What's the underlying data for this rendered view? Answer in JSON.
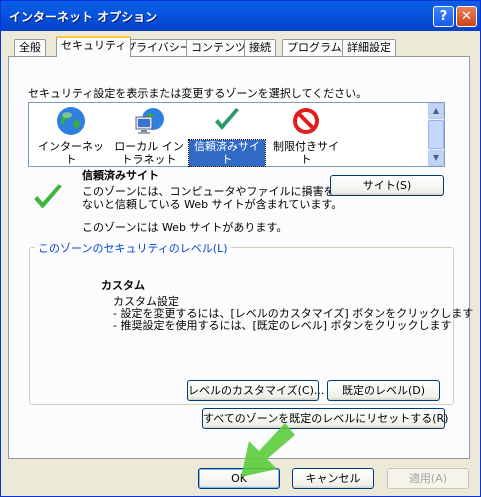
{
  "window": {
    "title": "インターネット オプション"
  },
  "tabs": [
    {
      "label": "全般"
    },
    {
      "label": "セキュリティ"
    },
    {
      "label": "プライバシー"
    },
    {
      "label": "コンテンツ"
    },
    {
      "label": "接続"
    },
    {
      "label": "プログラム"
    },
    {
      "label": "詳細設定"
    }
  ],
  "zones": {
    "prompt": "セキュリティ設定を表示または変更するゾーンを選択してください。",
    "items": [
      {
        "label": "インターネット",
        "icon": "globe-icon"
      },
      {
        "label": "ローカル イントラネット",
        "icon": "intranet-icon"
      },
      {
        "label": "信頼済みサイト",
        "icon": "checkmark-icon"
      },
      {
        "label": "制限付きサイト",
        "icon": "restricted-icon"
      }
    ],
    "selected": 2
  },
  "zone_info": {
    "title": "信頼済みサイト",
    "desc1": "このゾーンには、コンピュータやファイルに損害を与え",
    "desc2": "ないと信頼している Web サイトが含まれています。",
    "note": "このゾーンには Web サイトがあります。",
    "sites_button": "サイト(S)"
  },
  "level_group": {
    "legend": "このゾーンのセキュリティのレベル(L)",
    "heading": "カスタム",
    "line1": "カスタム設定",
    "line2": "- 設定を変更するには、[レベルのカスタマイズ] ボタンをクリックします",
    "line3": "- 推奨設定を使用するには、[既定のレベル] ボタンをクリックします",
    "customize_button": "レベルのカスタマイズ(C)...",
    "default_button": "既定のレベル(D)"
  },
  "reset_all_button": "すべてのゾーンを既定のレベルにリセットする(R)",
  "footer": {
    "ok": "OK",
    "cancel": "キャンセル",
    "apply": "適用(A)"
  },
  "colors": {
    "titlebar": "#0655e0",
    "tab_highlight": "#ffc83c",
    "selection": "#316ac5",
    "legend": "#0046d5",
    "arrow": "#5ccc3c"
  }
}
